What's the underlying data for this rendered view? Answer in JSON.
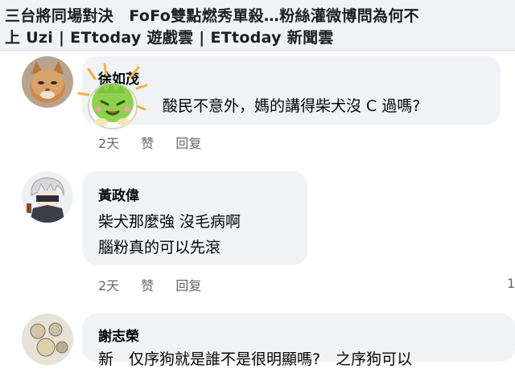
{
  "header": {
    "line1": "三台將同場對決　FoFo雙點燃秀單殺…粉絲灌微博問為何不",
    "line2": "上 Uzi | ETtoday 遊戲雲 | ETtoday 新聞雲"
  },
  "comments": [
    {
      "author": "徐如茂",
      "text": "酸民不意外，媽的講得柴犬沒 C 過嗎?",
      "time": "2天",
      "like": "赞",
      "reply": "回复"
    },
    {
      "author": "黃政偉",
      "line1": "柴犬那麼強 沒毛病啊",
      "line2": "腦粉真的可以先滾",
      "time": "2天",
      "like": "赞",
      "reply": "回复",
      "count": "1"
    },
    {
      "author": "謝志榮",
      "text": "新　仅序狗就是誰不是很明顯嗎?　之序狗可以"
    }
  ],
  "colors": {
    "bubble": "#f0f2f5",
    "meta_text": "#65676b",
    "sticker_green": "#8fd14f"
  },
  "icons": [
    "cat-avatar",
    "cartoon-sticker",
    "anime-avatar",
    "drawn-avatar"
  ]
}
